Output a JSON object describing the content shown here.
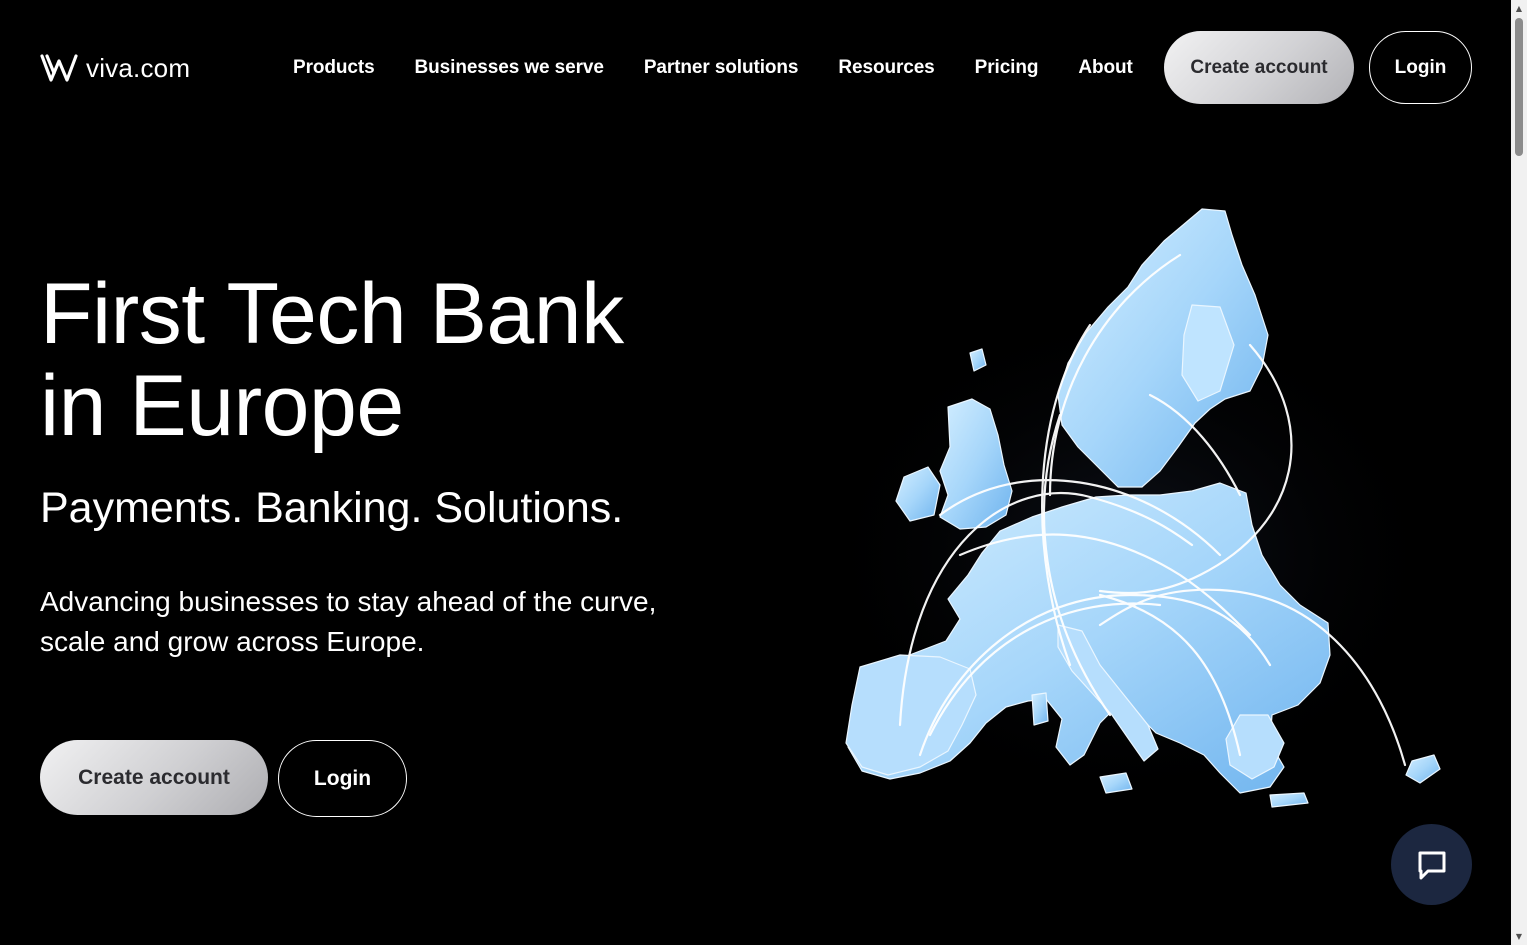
{
  "brand": {
    "name": "viva.com",
    "logo_icon": "viva-logo-icon"
  },
  "nav": {
    "items": [
      {
        "label": "Products"
      },
      {
        "label": "Businesses we serve"
      },
      {
        "label": "Partner solutions"
      },
      {
        "label": "Resources"
      },
      {
        "label": "Pricing"
      },
      {
        "label": "About"
      }
    ],
    "create_account": "Create account",
    "login": "Login"
  },
  "hero": {
    "title_line1": "First Tech Bank",
    "title_line2": "in Europe",
    "subtitle": "Payments. Banking. Solutions.",
    "description_line1": "Advancing businesses to stay ahead of the curve,",
    "description_line2": "scale and grow across Europe.",
    "create_account": "Create account",
    "login": "Login"
  },
  "map": {
    "icon": "europe-map-illustration"
  },
  "chat": {
    "icon": "chat-bubble-icon"
  },
  "colors": {
    "background": "#000000",
    "text": "#ffffff",
    "button_primary_text": "#2b2b2f",
    "map_fill": "#a9d8fb",
    "chat_bg": "#1c2740"
  }
}
